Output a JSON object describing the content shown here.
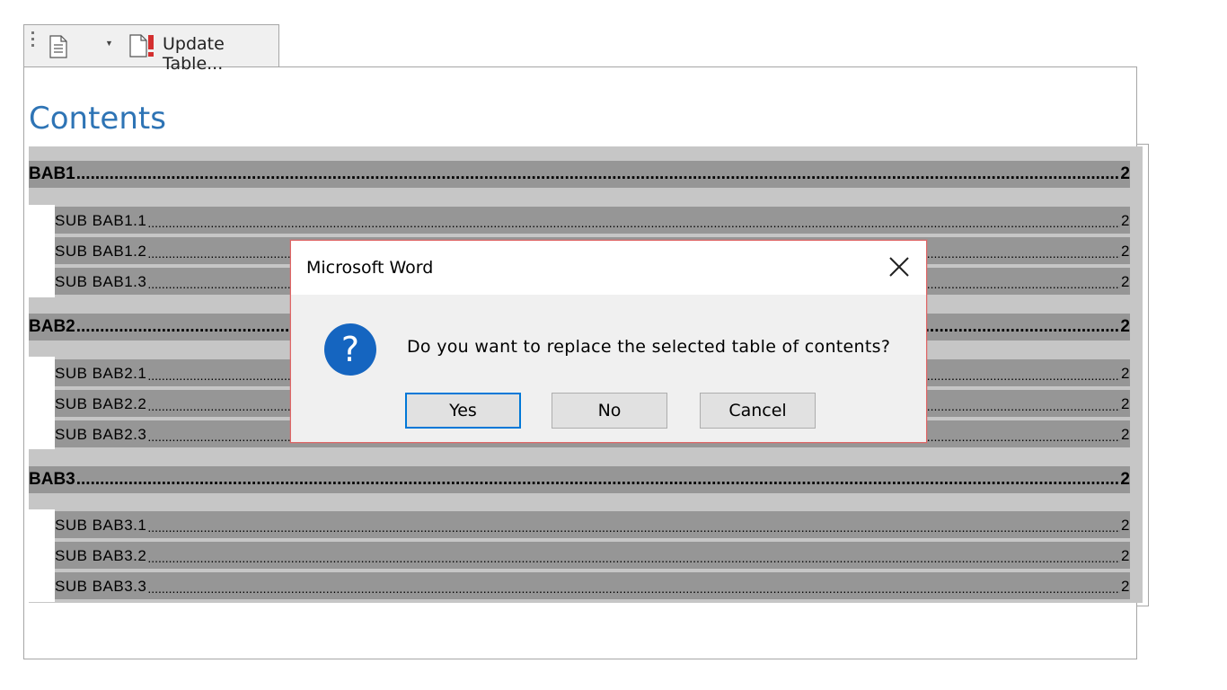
{
  "toolbar": {
    "update_table_label": "Update Table..."
  },
  "document": {
    "heading": "Contents",
    "toc_entries": [
      {
        "level": 1,
        "text": "BAB1",
        "page": "2"
      },
      {
        "level": 2,
        "text": "SUB BAB1.1",
        "page": "2"
      },
      {
        "level": 2,
        "text": "SUB BAB1.2",
        "page": "2"
      },
      {
        "level": 2,
        "text": "SUB BAB1.3",
        "page": "2"
      },
      {
        "level": 1,
        "text": "BAB2",
        "page": "2"
      },
      {
        "level": 2,
        "text": "SUB BAB2.1",
        "page": "2"
      },
      {
        "level": 2,
        "text": "SUB BAB2.2",
        "page": "2"
      },
      {
        "level": 2,
        "text": "SUB BAB2.3",
        "page": "2"
      },
      {
        "level": 1,
        "text": "BAB3",
        "page": "2"
      },
      {
        "level": 2,
        "text": "SUB BAB3.1",
        "page": "2"
      },
      {
        "level": 2,
        "text": "SUB BAB3.2",
        "page": "2"
      },
      {
        "level": 2,
        "text": "SUB BAB3.3",
        "page": "2"
      }
    ]
  },
  "dialog": {
    "title": "Microsoft Word",
    "icon": "question-icon",
    "message": "Do you want to replace the selected table of contents?",
    "buttons": {
      "yes": "Yes",
      "no": "No",
      "cancel": "Cancel"
    }
  },
  "colors": {
    "heading_blue": "#2e74b5",
    "toc_field_shading": "#969696",
    "toc_selection_bg": "#c6c6c6",
    "dialog_border": "#e06666",
    "question_icon_blue": "#1565c0",
    "default_button_border": "#0078d7"
  }
}
